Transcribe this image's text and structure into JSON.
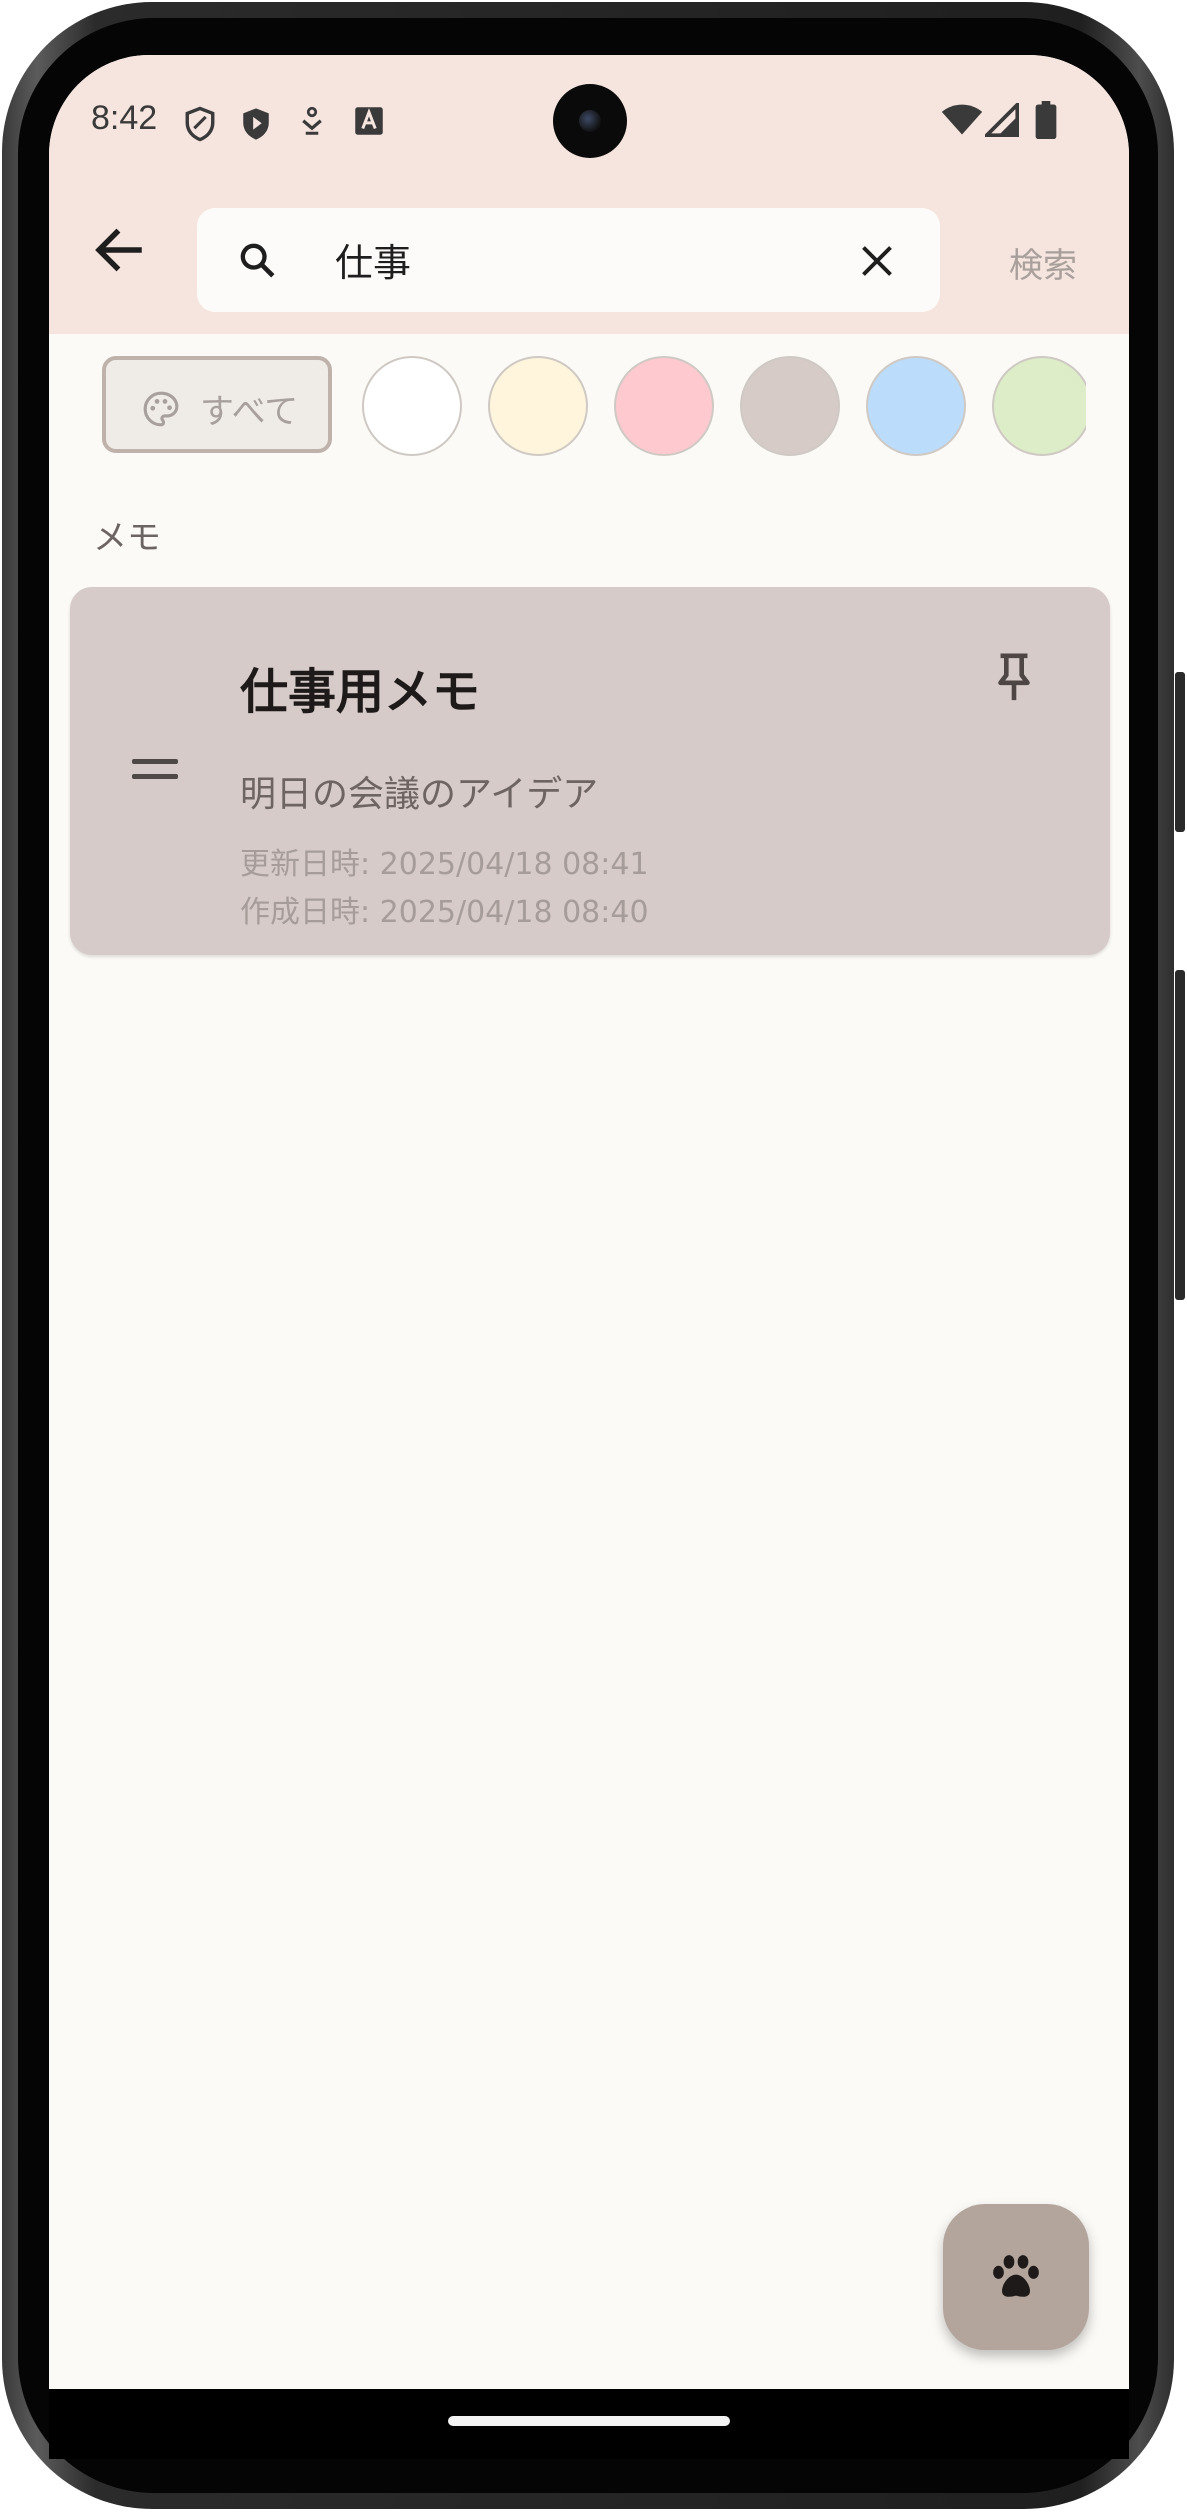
{
  "status_bar": {
    "time": "8:42",
    "left_icons": [
      "shield-outline-icon",
      "shield-play-icon",
      "download-person-icon",
      "text-a-icon"
    ],
    "right_icons": [
      "wifi-icon",
      "signal-icon",
      "battery-icon"
    ]
  },
  "header": {
    "search_value": "仕事",
    "search_action_label": "検索"
  },
  "filters": {
    "all_label": "すべて",
    "colors": [
      "#ffffff",
      "#fff5dc",
      "#ffc9d0",
      "#d7cbc8",
      "#bcdcfb",
      "#dcedc8"
    ]
  },
  "section": {
    "label": "メモ"
  },
  "notes": [
    {
      "title": "仕事用メモ",
      "body": "明日の会議のアイデア",
      "updated": "更新日時: 2025/04/18 08:41",
      "created": "作成日時: 2025/04/18 08:40",
      "pinned": true,
      "color": "#d6cbc8"
    }
  ],
  "fab": {
    "icon": "paw-icon"
  },
  "colors": {
    "header_bg": "#f6e5df",
    "page_bg": "#fcfaf6",
    "fab_bg": "#b4a59c"
  }
}
